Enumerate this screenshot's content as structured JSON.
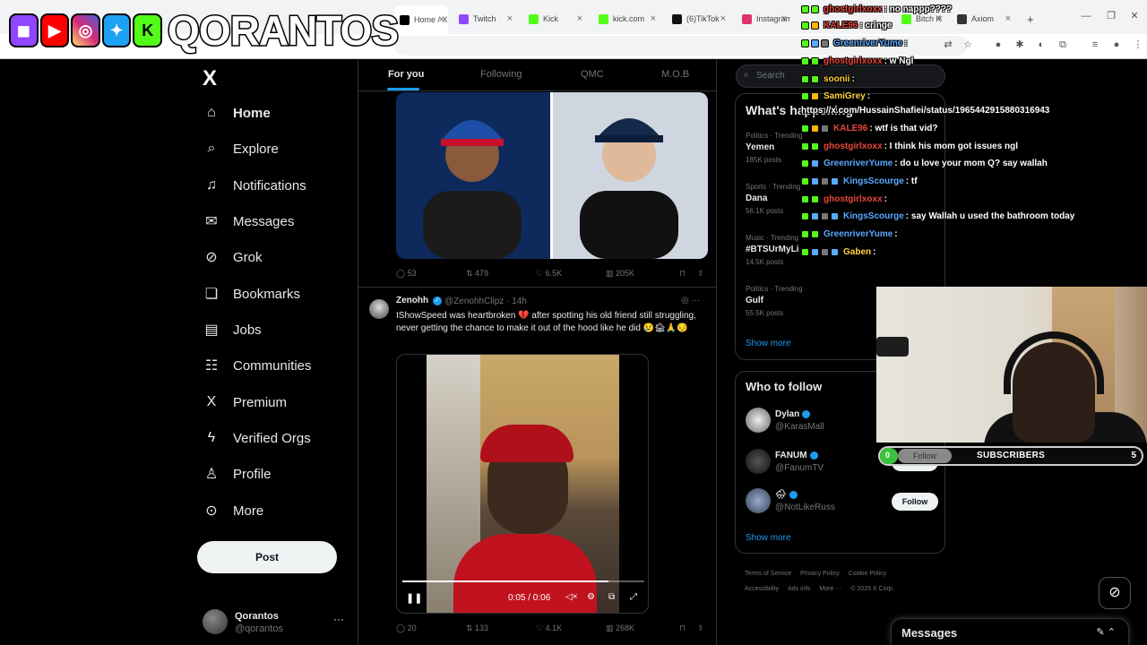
{
  "browser": {
    "tabs": [
      {
        "label": "Home / X",
        "color": "#000000"
      },
      {
        "label": "Twitch",
        "color": "#9146ff"
      },
      {
        "label": "Kick",
        "color": "#53fc18"
      },
      {
        "label": "kick.com",
        "color": "#53fc18"
      },
      {
        "label": "(6)TikTok",
        "color": "#111111"
      },
      {
        "label": "Instagram",
        "color": "#e1306c"
      },
      {
        "label": "Bitch K",
        "color": "#53fc18"
      },
      {
        "label": "Axiom",
        "color": "#333333"
      }
    ],
    "new_tab": "+"
  },
  "overlay": {
    "brand": "QORANTOS",
    "platform_icons": [
      "twitch-icon",
      "youtube-icon",
      "instagram-icon",
      "twitter-bird-icon",
      "kick-icon"
    ]
  },
  "nav": {
    "logo": "X",
    "items": [
      {
        "label": "Home",
        "icon": "⌂",
        "bold": true
      },
      {
        "label": "Explore",
        "icon": "⌕"
      },
      {
        "label": "Notifications",
        "icon": "♫"
      },
      {
        "label": "Messages",
        "icon": "✉"
      },
      {
        "label": "Grok",
        "icon": "⊘"
      },
      {
        "label": "Bookmarks",
        "icon": "❏"
      },
      {
        "label": "Jobs",
        "icon": "▤"
      },
      {
        "label": "Communities",
        "icon": "☷"
      },
      {
        "label": "Premium",
        "icon": "X"
      },
      {
        "label": "Verified Orgs",
        "icon": "ϟ"
      },
      {
        "label": "Profile",
        "icon": "♙"
      },
      {
        "label": "More",
        "icon": "⊙"
      }
    ],
    "post_button": "Post",
    "profile_name": "Qorantos",
    "profile_handle": "@qorantos",
    "profile_more": "···"
  },
  "feed": {
    "tabs": [
      "For you",
      "Following",
      "QMC",
      "M.O.B"
    ],
    "tweet1": {
      "replies": "53",
      "reposts": "479",
      "likes": "6.5K",
      "views": "205K"
    },
    "tweet2": {
      "name": "Zenohh",
      "handle": "@ZenohhClipz · 14h",
      "text": "IShowSpeed was heartbroken 💔 after spotting his old friend still struggling, never getting the chance to make it out of the hood like he did 😢🏚🙏😔",
      "video_time": "0:05 / 0:06",
      "progress": 0.85,
      "replies": "20",
      "reposts": "133",
      "likes": "4.1K",
      "views": "268K"
    }
  },
  "right": {
    "search_placeholder": "Search",
    "trends_title": "What's happening",
    "trends": [
      {
        "category": "Politics · Trending",
        "name": "Yemen",
        "count": "185K posts"
      },
      {
        "category": "Sports · Trending",
        "name": "Dana",
        "count": "56.1K posts"
      },
      {
        "category": "Music · Trending",
        "name": "#BTSUrMyLi",
        "count": "14.5K posts"
      },
      {
        "category": "Politics · Trending",
        "name": "Gulf",
        "count": "55.5K posts"
      }
    ],
    "show_more": "Show more",
    "who_to_follow_title": "Who to follow",
    "who_to_follow": [
      {
        "name": "Dylan",
        "handle": "@KarasMall",
        "button": "Follow"
      },
      {
        "name": "FANUM",
        "handle": "@FanumTV",
        "button": "Follow"
      },
      {
        "name": "🌧",
        "handle": "@NotLikeRuss",
        "button": "Follow"
      }
    ],
    "footer": [
      "Terms of Service",
      "Privacy Policy",
      "Cookie Policy",
      "Accessibility",
      "Ads info",
      "More ···",
      "© 2025 X Corp."
    ]
  },
  "stream": {
    "sub_count": "0",
    "sub_follow": "Follow",
    "sub_label": "SUBSCRIBERS",
    "sub_goal": "5",
    "sub_progress": 0.0
  },
  "chat": [
    {
      "user": "ghostgirlxoxx",
      "text": ": no nappp????",
      "color": "#e8473c"
    },
    {
      "user": "KALE96",
      "text": ": cringe",
      "color": "#e8473c"
    },
    {
      "user": "GreenriverYume",
      "text": ":",
      "color": "#5aa9ff"
    },
    {
      "user": "ghostgirlxoxx",
      "text": ": w Ngl",
      "color": "#e8473c"
    },
    {
      "user": "soonii",
      "text": ":",
      "color": "#ffd23c"
    },
    {
      "user": "SamiGrey",
      "text": ":",
      "color": "#ffd23c"
    },
    {
      "user": "",
      "text": "https://x.com/HussainShafiei/status/1965442915880316943",
      "color": "#ffffff"
    },
    {
      "user": "KALE96",
      "text": ": wtf is that vid?",
      "color": "#e8473c"
    },
    {
      "user": "ghostgirlxoxx",
      "text": ": I think his mom got issues ngl",
      "color": "#e8473c"
    },
    {
      "user": "GreenriverYume",
      "text": ": do u love your mom Q? say wallah",
      "color": "#5aa9ff"
    },
    {
      "user": "KingsScourge",
      "text": ": tf",
      "color": "#5aa9ff"
    },
    {
      "user": "ghostgirlxoxx",
      "text": ":",
      "color": "#e8473c"
    },
    {
      "user": "KingsScourge",
      "text": ": say Wallah u used the bathroom today",
      "color": "#5aa9ff"
    },
    {
      "user": "GreenriverYume",
      "text": ":",
      "color": "#5aa9ff"
    },
    {
      "user": "Gaben",
      "text": ":",
      "color": "#ffd23c"
    }
  ],
  "dock": {
    "title": "Messages",
    "icons": "✎  ⌃"
  },
  "grok_icon": "⊘"
}
